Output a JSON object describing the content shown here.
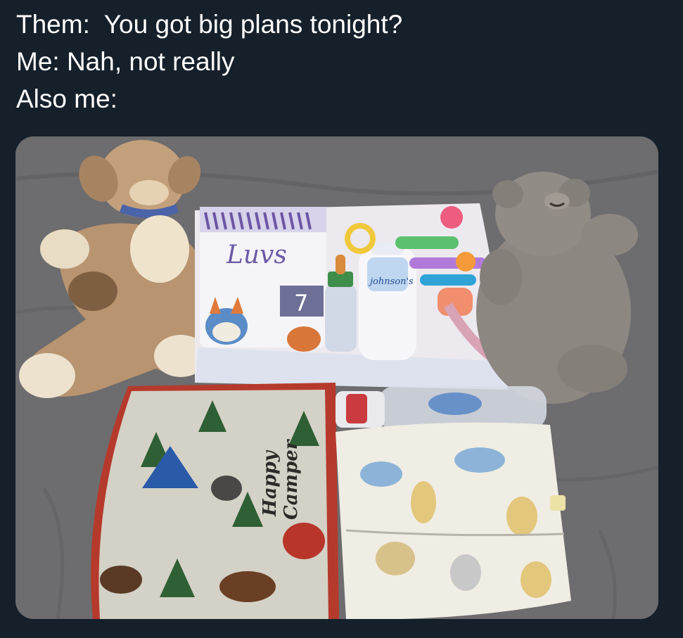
{
  "tweet": {
    "lines": [
      "Them:  You got big plans tonight?",
      "Me: Nah, not really",
      "Also me:"
    ]
  },
  "photo": {
    "diaper_brand": "Luvs",
    "diaper_size": "7",
    "lotion_brand": "johnson's",
    "blanket_text_1": "Happy",
    "blanket_text_2": "Camper"
  },
  "colors": {
    "background": "#15202b",
    "text": "#ffffff",
    "bedsheet": "#6b6b6b"
  }
}
